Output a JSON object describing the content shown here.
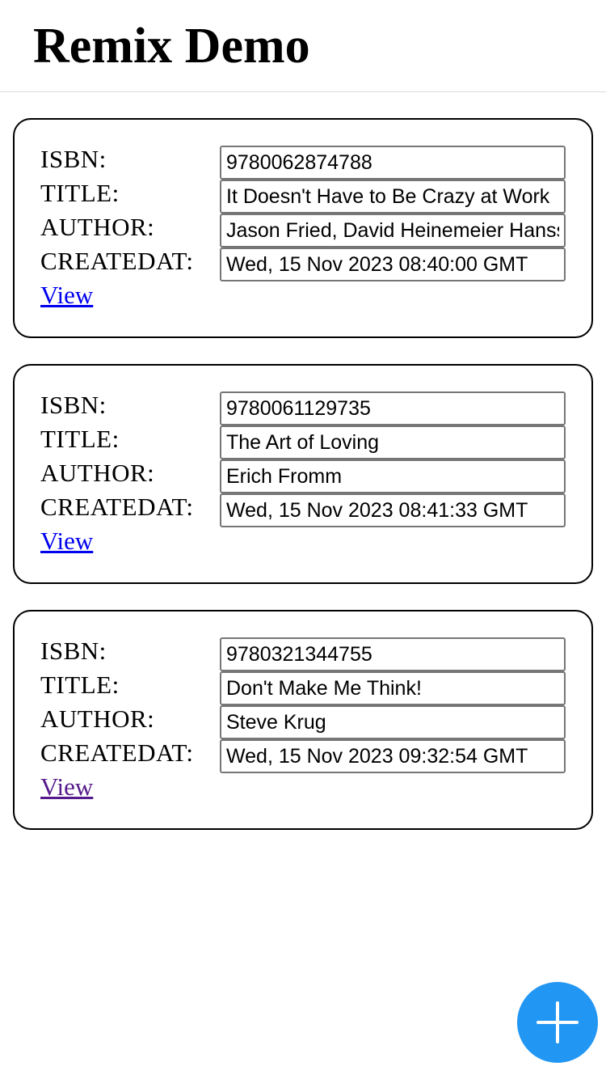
{
  "header": {
    "title": "Remix Demo"
  },
  "labels": {
    "isbn": "ISBN:",
    "title": "TITLE:",
    "author": "AUTHOR:",
    "createdat": "CREATEDAT:",
    "view": "View"
  },
  "books": [
    {
      "isbn": "9780062874788",
      "title": "It Doesn't Have to Be Crazy at Work",
      "author": "Jason Fried, David Heinemeier Hansson",
      "createdAt": "Wed, 15 Nov 2023 08:40:00 GMT",
      "view_visited": false
    },
    {
      "isbn": "9780061129735",
      "title": "The Art of Loving",
      "author": "Erich Fromm",
      "createdAt": "Wed, 15 Nov 2023 08:41:33 GMT",
      "view_visited": false
    },
    {
      "isbn": "9780321344755",
      "title": "Don't Make Me Think!",
      "author": "Steve Krug",
      "createdAt": "Wed, 15 Nov 2023 09:32:54 GMT",
      "view_visited": true
    }
  ],
  "fab": {
    "icon": "plus-icon",
    "color": "#2196f3"
  },
  "colors": {
    "link": "#0000ee",
    "link_visited": "#551a8b"
  }
}
